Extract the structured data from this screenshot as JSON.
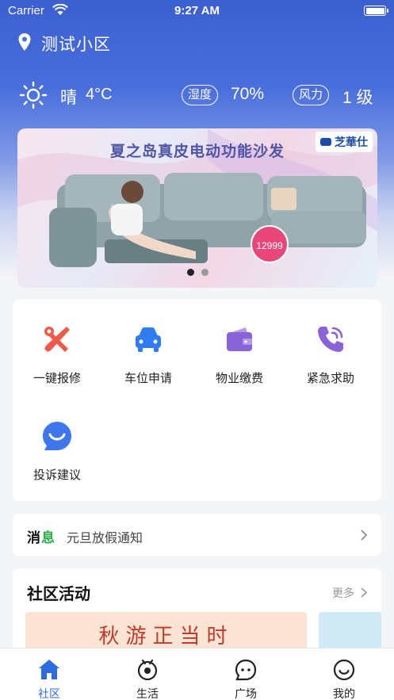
{
  "status_bar": {
    "carrier": "Carrier",
    "time": "9:27 AM"
  },
  "location": {
    "name": "测试小区"
  },
  "weather": {
    "condition": "晴",
    "temperature": "4°C",
    "humidity_label": "湿度",
    "humidity_value": "70%",
    "wind_label": "风力",
    "wind_value": "1 级"
  },
  "banner": {
    "title": "夏之岛真皮电动功能沙发",
    "brand": "芝華仕",
    "price": "12999",
    "slide_count": 2,
    "active_slide": 0
  },
  "services": [
    {
      "label": "一键报修",
      "icon": "repair-tools-icon",
      "color": "#f05a4a"
    },
    {
      "label": "车位申请",
      "icon": "car-icon",
      "color": "#2f7bf0"
    },
    {
      "label": "物业缴费",
      "icon": "wallet-icon",
      "color": "#8b63d9"
    },
    {
      "label": "紧急求助",
      "icon": "phone-call-icon",
      "color": "#8b63d9"
    },
    {
      "label": "投诉建议",
      "icon": "chat-smile-icon",
      "color": "#3f76ec"
    }
  ],
  "notice": {
    "tag_part1": "消",
    "tag_part2": "息",
    "text": "元旦放假通知"
  },
  "activity": {
    "title": "社区活动",
    "more": "更多",
    "card_title": "秋游正当时"
  },
  "tabbar": [
    {
      "label": "社区",
      "icon": "home-icon",
      "active": true
    },
    {
      "label": "生活",
      "icon": "life-icon",
      "active": false
    },
    {
      "label": "广场",
      "icon": "plaza-chat-icon",
      "active": false
    },
    {
      "label": "我的",
      "icon": "profile-smile-icon",
      "active": false
    }
  ],
  "colors": {
    "accent": "#2f6be0",
    "header_blue": "#3b5fd0",
    "notice_green": "#2cae48"
  }
}
